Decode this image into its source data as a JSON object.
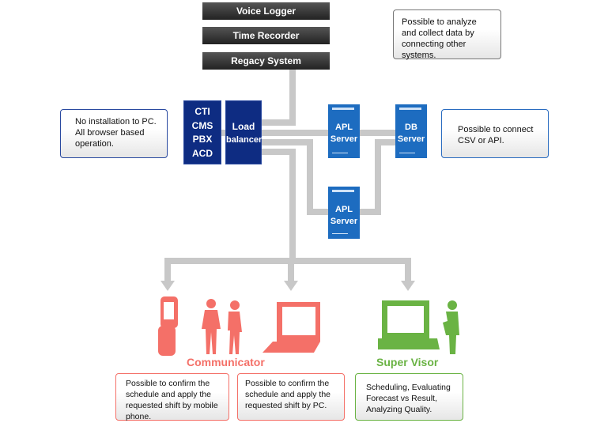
{
  "systems": [
    "Voice Logger",
    "Time Recorder",
    "Regacy System"
  ],
  "notes": {
    "top_right": "Possible to analyze and collect data by connecting other systems.",
    "left": "No installation to PC. All browser based operation.",
    "right": "Possible to connect CSV or API."
  },
  "cti": [
    "CTI",
    "CMS",
    "PBX",
    "ACD"
  ],
  "load_balancer": [
    "Load",
    "balancer"
  ],
  "servers": {
    "apl1": [
      "APL",
      "Server"
    ],
    "db": [
      "DB",
      "Server"
    ],
    "apl2": [
      "APL",
      "Server"
    ]
  },
  "groups": {
    "communicator": "Communicator",
    "supervisor": "Super Visor"
  },
  "bottom_notes": [
    "Possible to confirm the schedule and apply the requested shift by mobile phone.",
    "Possible to confirm the schedule and apply the requested shift by PC.",
    "Scheduling, Evaluating Forecast vs Result, Analyzing Quality."
  ],
  "colors": {
    "navy": "#0e2c82",
    "server": "#1d6cc0",
    "communicator": "#f47068",
    "supervisor": "#6ab344",
    "line": "#c8c8c8"
  }
}
